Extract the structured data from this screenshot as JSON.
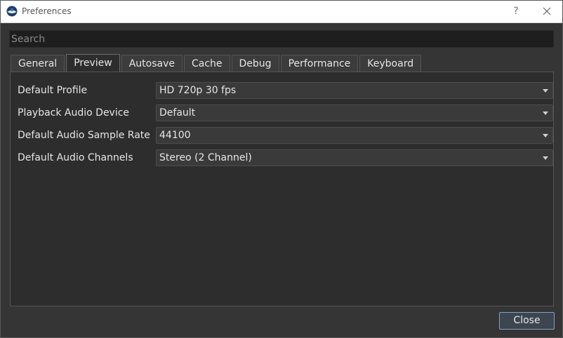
{
  "window": {
    "title": "Preferences",
    "help_label": "?"
  },
  "search": {
    "placeholder": "Search",
    "value": ""
  },
  "tabs": [
    {
      "label": "General"
    },
    {
      "label": "Preview"
    },
    {
      "label": "Autosave"
    },
    {
      "label": "Cache"
    },
    {
      "label": "Debug"
    },
    {
      "label": "Performance"
    },
    {
      "label": "Keyboard"
    }
  ],
  "active_tab": "Preview",
  "settings": [
    {
      "label": "Default Profile",
      "value": "HD 720p 30 fps"
    },
    {
      "label": "Playback Audio Device",
      "value": "Default"
    },
    {
      "label": "Default Audio Sample Rate",
      "value": "44100"
    },
    {
      "label": "Default Audio Channels",
      "value": "Stereo (2 Channel)"
    }
  ],
  "footer": {
    "close_label": "Close"
  },
  "colors": {
    "background": "#353535",
    "panel": "#2d2d2d",
    "accent": "#7fa3c6"
  }
}
